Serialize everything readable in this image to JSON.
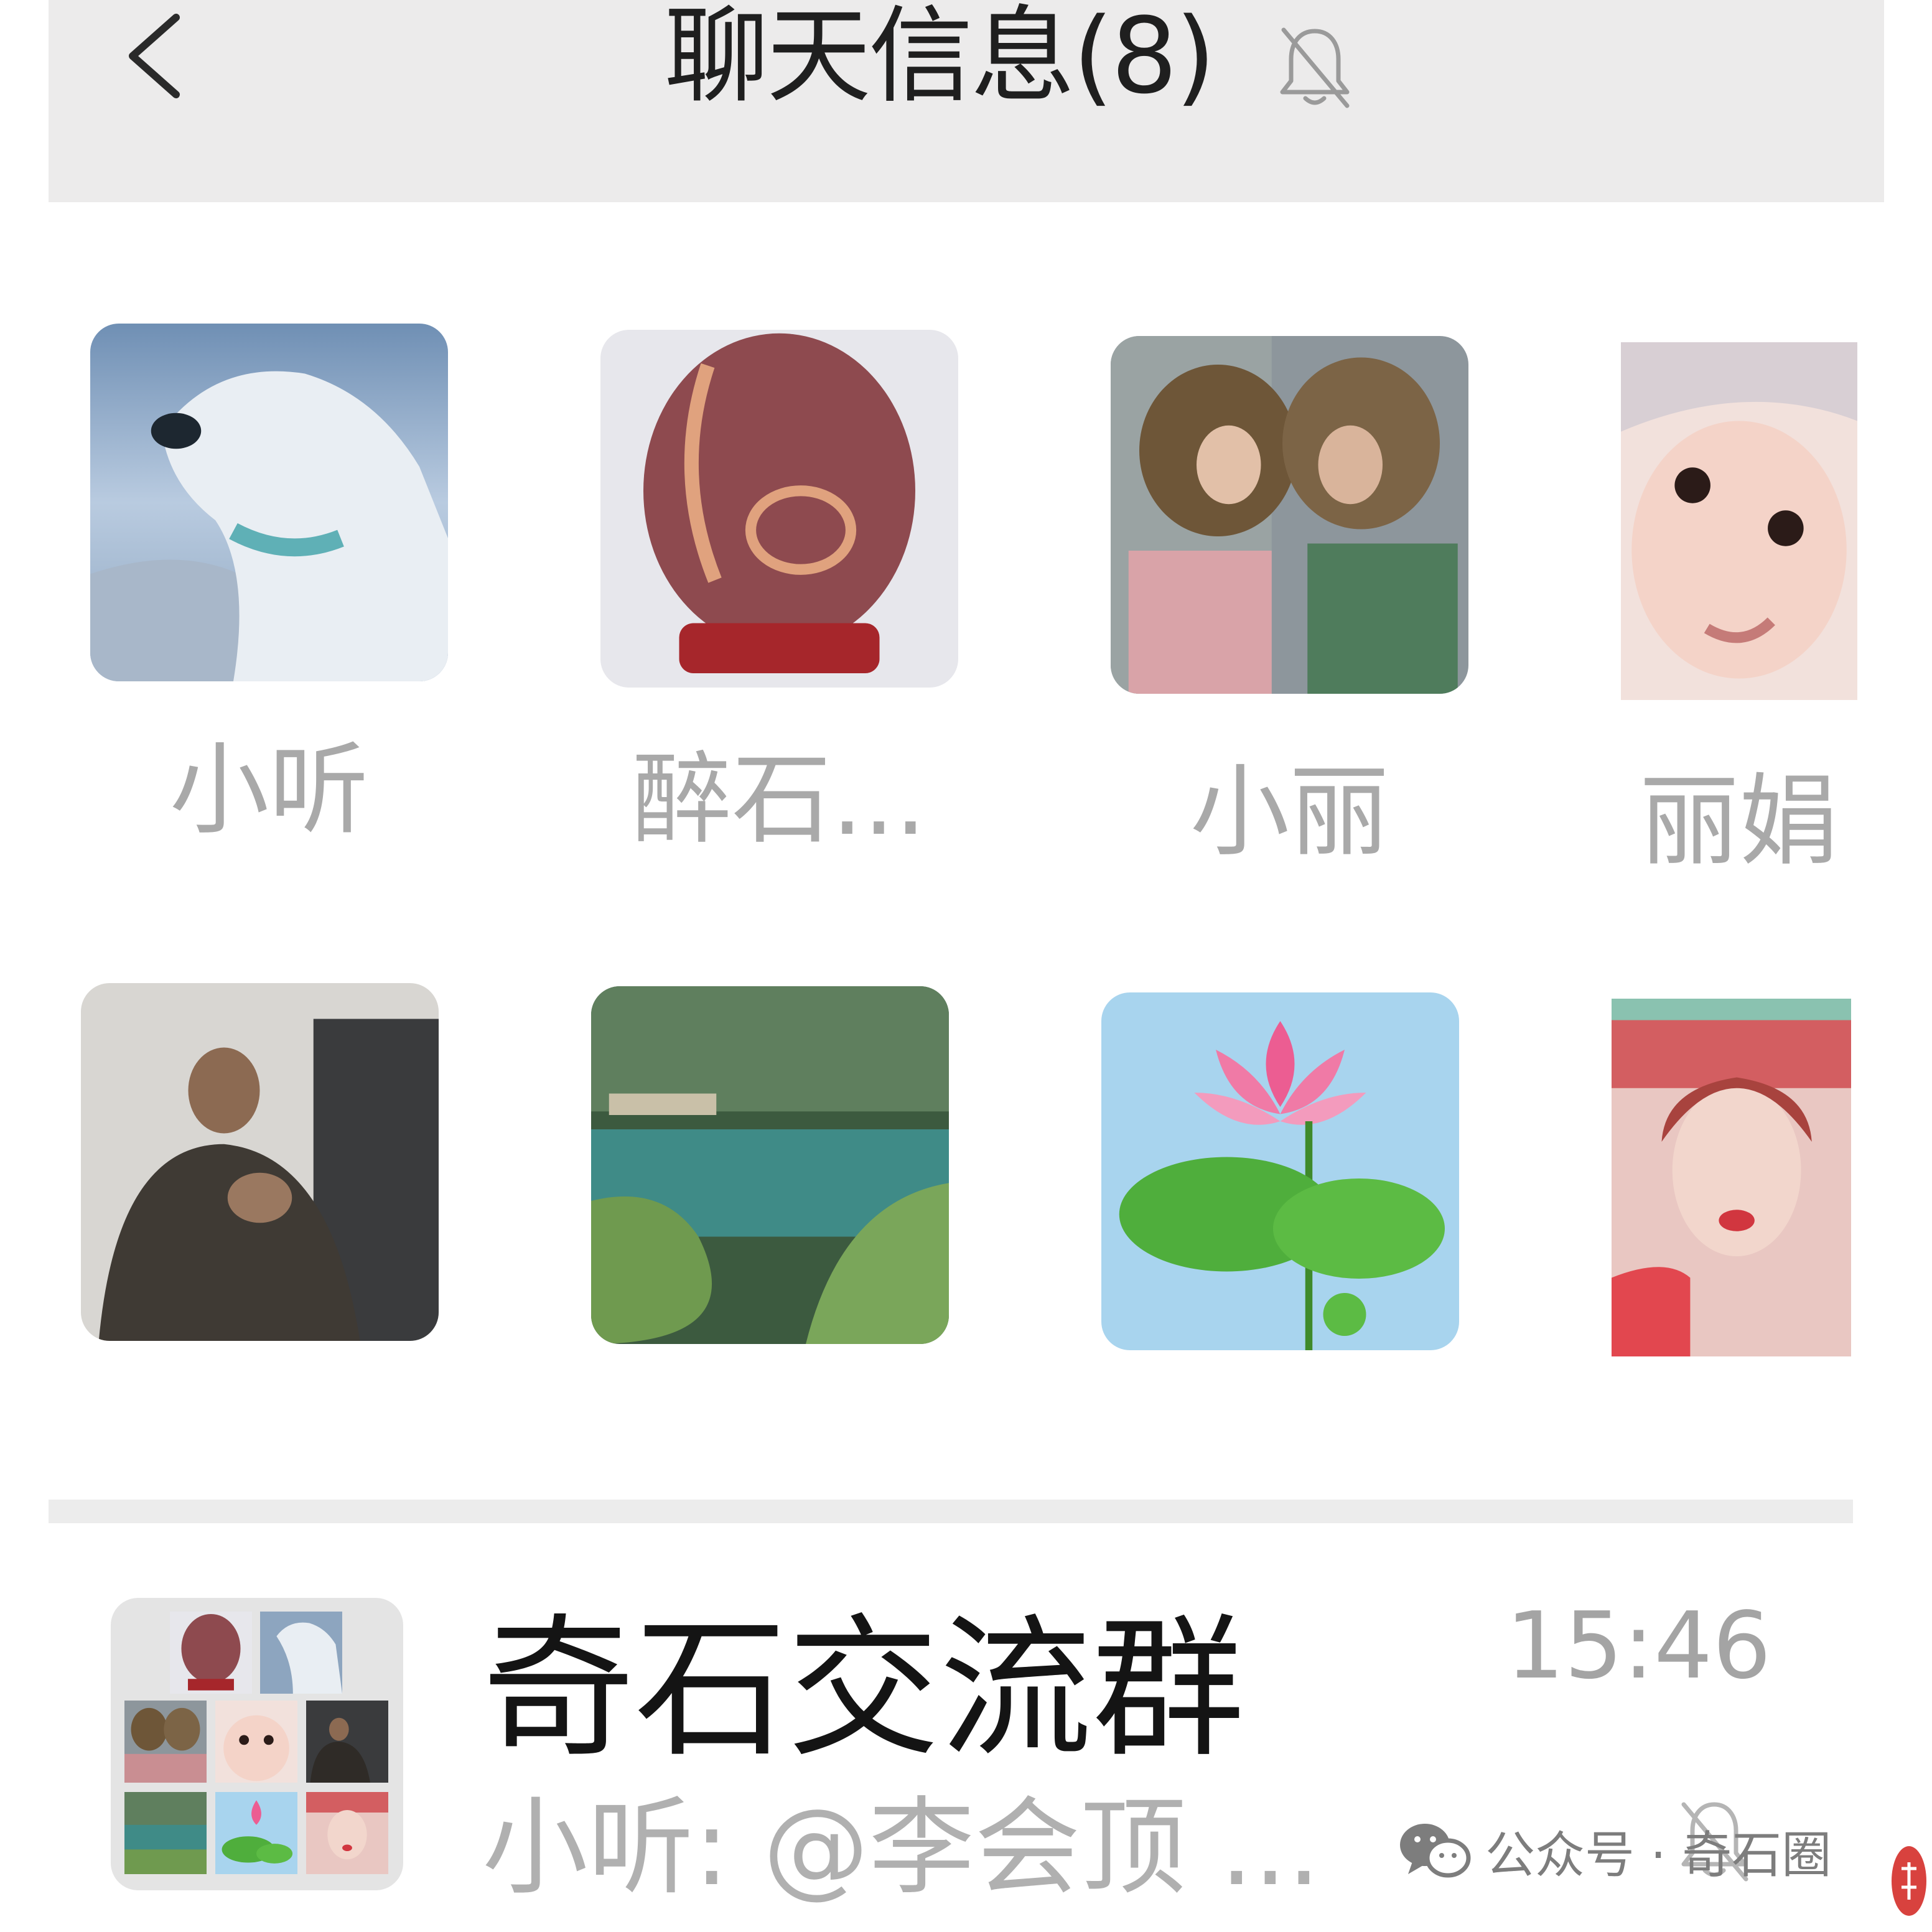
{
  "header": {
    "title": "聊天信息(8)",
    "back_icon": "chevron-left-icon",
    "mute_icon": "bell-off-icon"
  },
  "members": [
    {
      "name": "小听",
      "avatar": "polar-bear"
    },
    {
      "name": "醉石...",
      "avatar": "red-stone-on-stand"
    },
    {
      "name": "小丽",
      "avatar": "two-women"
    },
    {
      "name": "丽娟",
      "avatar": "baby-face"
    },
    {
      "name": "",
      "avatar": "man-seated"
    },
    {
      "name": "",
      "avatar": "lake-landscape"
    },
    {
      "name": "",
      "avatar": "lotus-flower"
    },
    {
      "name": "",
      "avatar": "woman-selfie"
    }
  ],
  "chat": {
    "name": "奇石交流群",
    "time": "15:46",
    "preview": "小听: @李会顶 ...",
    "mute_icon": "bell-off-icon"
  },
  "watermark": {
    "text": "公众号 · 奇石圈",
    "icon": "wechat-icon"
  },
  "colors": {
    "header_bg": "#ecebeb",
    "title_text": "#1f1f1f",
    "member_name": "#a9a9a9",
    "chat_name": "#141414",
    "secondary_text": "#a4a4a4",
    "divider": "#ececec"
  }
}
